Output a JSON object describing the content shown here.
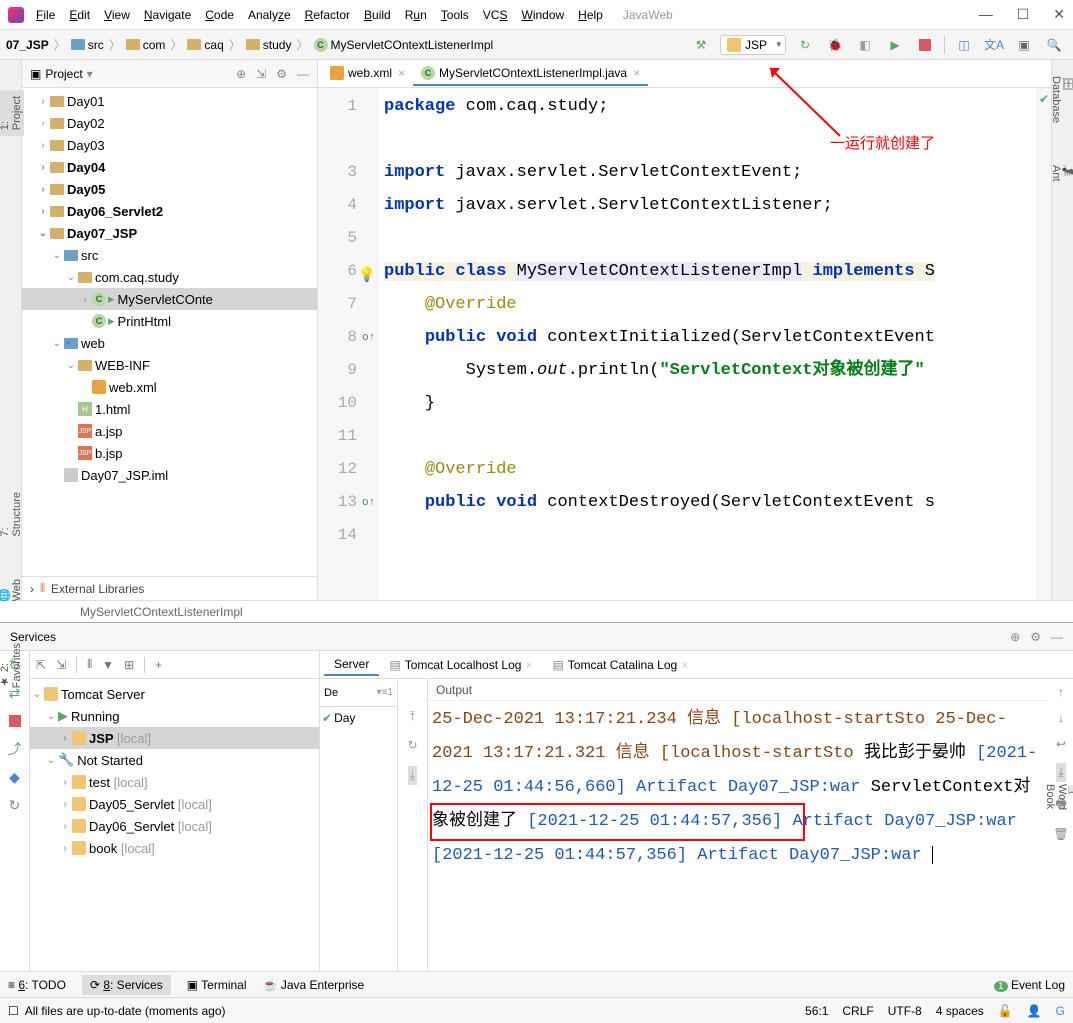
{
  "app": {
    "name": "JavaWeb"
  },
  "menu": [
    "File",
    "Edit",
    "View",
    "Navigate",
    "Code",
    "Analyze",
    "Refactor",
    "Build",
    "Run",
    "Tools",
    "VCS",
    "Window",
    "Help"
  ],
  "breadcrumb": {
    "root": "07_JSP",
    "src": "src",
    "com": "com",
    "caq": "caq",
    "study": "study",
    "cls": "MyServletCOntextListenerImpl"
  },
  "run_config": "JSP",
  "annotation": "一运行就创建了",
  "project": {
    "title": "Project",
    "days": [
      "Day01",
      "Day02",
      "Day03",
      "Day04",
      "Day05",
      "Day06_Servlet2",
      "Day07_JSP"
    ],
    "day07": {
      "src": "src",
      "pkg": "com.caq.study",
      "cls1": "MyServletCOnte",
      "cls2": "PrintHtml",
      "web": "web",
      "webinf": "WEB-INF",
      "webxml": "web.xml",
      "html": "1.html",
      "ajsp": "a.jsp",
      "bjsp": "b.jsp",
      "iml": "Day07_JSP.iml"
    },
    "ext": "External Libraries"
  },
  "tabs": {
    "t1": "web.xml",
    "t2": "MyServletCOntextListenerImpl.java"
  },
  "code": {
    "l1a": "package",
    "l1b": " com.caq.study;",
    "l3a": "import",
    "l3b": " javax.servlet.ServletContextEvent;",
    "l4a": "import",
    "l4b": " javax.servlet.ServletContextListener;",
    "l6a": "public",
    "l6b": "class",
    "l6c": "MyServletCOntextListenerImpl",
    "l6d": "implements",
    "l6e": "S",
    "l7": "@Override",
    "l8a": "public",
    "l8b": "void",
    "l8c": " contextInitialized(ServletContextEvent",
    "l9a": "        System.",
    "l9b": "out",
    "l9c": ".println(",
    "l9d": "\"ServletContext对象被创建了\"",
    "l10": "    }",
    "l12": "@Override",
    "l13a": "public",
    "l13b": "void",
    "l13c": " contextDestroyed(ServletContextEvent s"
  },
  "crumb": "MyServletCOntextListenerImpl",
  "services": {
    "title": "Services",
    "server_tab": "Server",
    "log1": "Tomcat Localhost Log",
    "log2": "Tomcat Catalina Log",
    "de": "De",
    "day": "Day",
    "output": "Output",
    "tree": {
      "root": "Tomcat Server",
      "running": "Running",
      "jsp": "JSP",
      "local": "[local]",
      "notstarted": "Not Started",
      "test": "test",
      "d5": "Day05_Servlet",
      "d6": "Day06_Servlet",
      "book": "book"
    },
    "console": {
      "l1": "25-Dec-2021 13:17:21.234 信息 [localhost-startSto",
      "l2": "25-Dec-2021 13:17:21.321 信息 [localhost-startSto",
      "l3": "我比彭于晏帅",
      "l4": "[2021-12-25 01:44:56,660] Artifact Day07_JSP:war",
      "l5": "ServletContext对象被创建了",
      "l6": "[2021-12-25 01:44:57,356] Artifact Day07_JSP:war",
      "l7": "[2021-12-25 01:44:57,356] Artifact Day07_JSP:war"
    }
  },
  "bottom": {
    "todo": "6: TODO",
    "svc": "8: Services",
    "term": "Terminal",
    "je": "Java Enterprise",
    "ev": "Event Log"
  },
  "status": {
    "msg": "All files are up-to-date (moments ago)",
    "pos": "56:1",
    "eol": "CRLF",
    "enc": "UTF-8",
    "indent": "4 spaces"
  }
}
